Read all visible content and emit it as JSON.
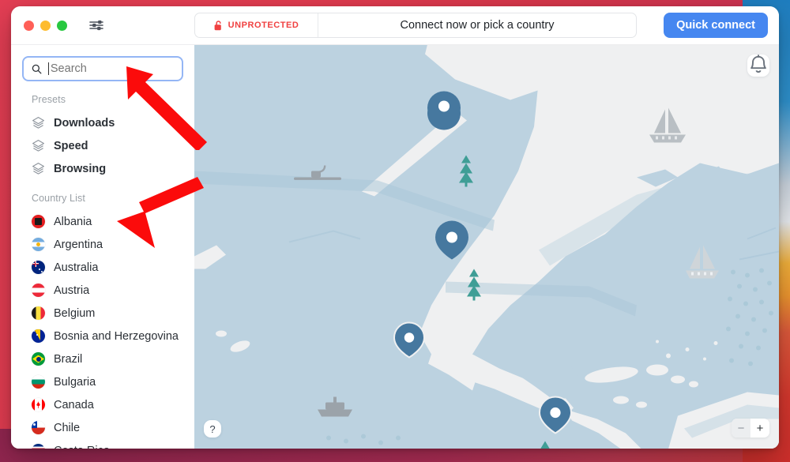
{
  "window": {
    "traffic_lights": [
      "close",
      "minimize",
      "maximize"
    ],
    "settings_icon": "sliders-icon"
  },
  "titlebar": {
    "status_badge": {
      "icon": "unlocked-padlock-icon",
      "label": "UNPROTECTED",
      "color": "#f04141"
    },
    "headline": "Connect now or pick a country",
    "quick_connect_label": "Quick connect",
    "quick_connect_color": "#4687f0"
  },
  "search": {
    "icon": "search-icon",
    "placeholder": "Search",
    "value": ""
  },
  "sidebar": {
    "presets_label": "Presets",
    "presets": [
      {
        "label": "Downloads",
        "icon": "layers-icon"
      },
      {
        "label": "Speed",
        "icon": "layers-icon"
      },
      {
        "label": "Browsing",
        "icon": "layers-icon"
      }
    ],
    "country_list_label": "Country List",
    "countries": [
      {
        "label": "Albania",
        "flag": "albania-flag"
      },
      {
        "label": "Argentina",
        "flag": "argentina-flag"
      },
      {
        "label": "Australia",
        "flag": "australia-flag"
      },
      {
        "label": "Austria",
        "flag": "austria-flag"
      },
      {
        "label": "Belgium",
        "flag": "belgium-flag"
      },
      {
        "label": "Bosnia and Herzegovina",
        "flag": "bosnia-and-herzegovina-flag"
      },
      {
        "label": "Brazil",
        "flag": "brazil-flag"
      },
      {
        "label": "Bulgaria",
        "flag": "bulgaria-flag"
      },
      {
        "label": "Canada",
        "flag": "canada-flag"
      },
      {
        "label": "Chile",
        "flag": "chile-flag"
      },
      {
        "label": "Costa Rica",
        "flag": "costa-rica-flag"
      }
    ]
  },
  "map": {
    "ocean_color": "#bcd2e0",
    "land_color": "#eff0f1",
    "pin_color": "#46789f",
    "tree_color": "#3f9e96",
    "notification_icon": "bell-icon",
    "help_label": "?",
    "zoom_out_label": "−",
    "zoom_in_label": "+",
    "server_pins": 4,
    "decorations": [
      "sailboat",
      "sailboat",
      "cargo-ship",
      "ferry",
      "pine-tree",
      "pine-tree",
      "pine-tree",
      "pine-tree"
    ]
  },
  "annotations": {
    "arrows": [
      {
        "name": "arrow-pointing-to-search-field",
        "direction": "up-left",
        "color": "#fb0b0b"
      },
      {
        "name": "arrow-pointing-to-country-list",
        "direction": "down-left",
        "color": "#fb0b0b"
      }
    ]
  }
}
